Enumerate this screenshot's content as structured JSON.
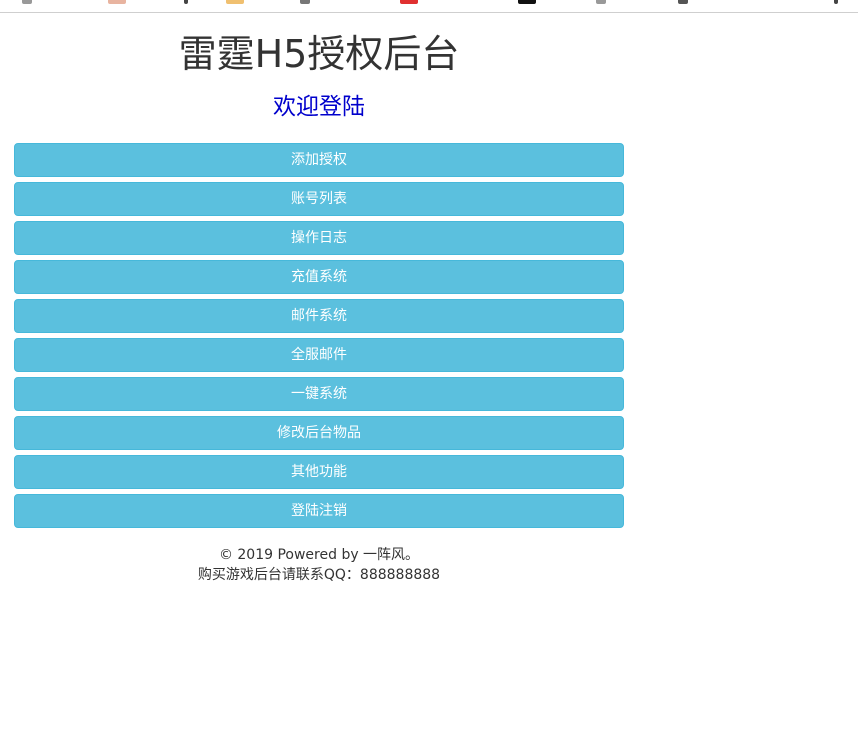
{
  "header": {
    "title": "雷霆H5授权后台",
    "subtitle": "欢迎登陆"
  },
  "menu": {
    "items": [
      {
        "label": "添加授权"
      },
      {
        "label": "账号列表"
      },
      {
        "label": "操作日志"
      },
      {
        "label": "充值系统"
      },
      {
        "label": "邮件系统"
      },
      {
        "label": "全服邮件"
      },
      {
        "label": "一键系统"
      },
      {
        "label": "修改后台物品"
      },
      {
        "label": "其他功能"
      },
      {
        "label": "登陆注销"
      }
    ]
  },
  "footer": {
    "copyright": "© 2019 Powered by 一阵风。",
    "contact": "购买游戏后台请联系QQ：888888888"
  },
  "colors": {
    "button_bg": "#5bc0de",
    "button_border": "#46b8da",
    "subtitle": "#0000cc",
    "title": "#333333"
  }
}
